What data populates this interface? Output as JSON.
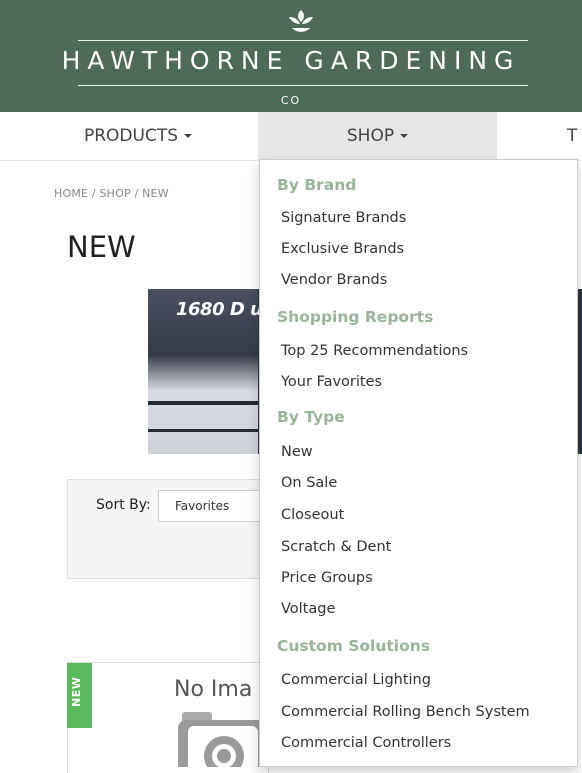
{
  "brand": {
    "name": "HAWTHORNE GARDENING",
    "suffix": "CO",
    "logo_icon": "leaf-sprout-icon"
  },
  "nav": {
    "products": "PRODUCTS",
    "shop": "SHOP",
    "next_partial": "T"
  },
  "breadcrumb": "HOME / SHOP / NEW",
  "page_title": "NEW",
  "banner": {
    "text": "1680 D u"
  },
  "sort": {
    "label": "Sort By:",
    "value": "Favorites"
  },
  "product_card": {
    "badge": "NEW",
    "no_image_text": "No Ima",
    "placeholder_icon": "camera-icon"
  },
  "shop_menu": {
    "by_brand": {
      "header": "By Brand",
      "items": [
        "Signature Brands",
        "Exclusive Brands",
        "Vendor Brands"
      ]
    },
    "shopping_reports": {
      "header": "Shopping Reports",
      "items": [
        "Top 25 Recommendations",
        "Your Favorites"
      ]
    },
    "by_type": {
      "header": "By Type",
      "items": [
        "New",
        "On Sale",
        "Closeout",
        "Scratch & Dent",
        "Price Groups",
        "Voltage"
      ]
    },
    "custom_solutions": {
      "header": "Custom Solutions",
      "items": [
        "Commercial Lighting",
        "Commercial Rolling Bench System",
        "Commercial Controllers"
      ]
    }
  },
  "colors": {
    "header_bg": "#4d6b56",
    "menu_header": "#98b59a",
    "badge": "#5cb85c"
  }
}
